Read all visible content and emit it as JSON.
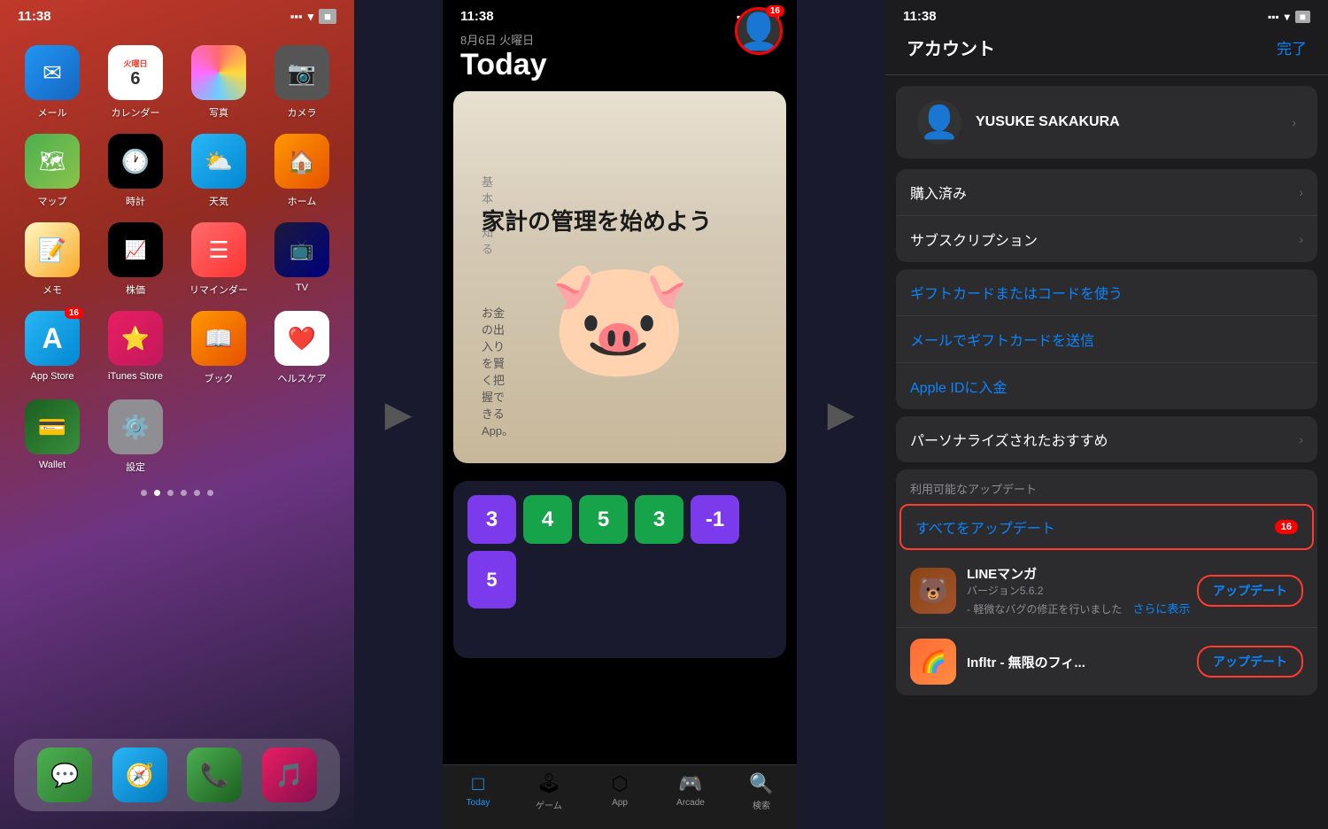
{
  "screen1": {
    "status": {
      "time": "11:38",
      "location_icon": "▲",
      "signal": "▪▪▪",
      "wifi": "WiFi",
      "battery": "🔋"
    },
    "apps_row1": [
      {
        "id": "mail",
        "label": "メール",
        "emoji": "✉️",
        "bg": "mail-bg",
        "badge": null
      },
      {
        "id": "calendar",
        "label": "カレンダー",
        "emoji": "cal",
        "bg": "calendar-bg",
        "badge": null
      },
      {
        "id": "photos",
        "label": "写真",
        "emoji": "🌈",
        "bg": "photos-bg",
        "badge": null
      },
      {
        "id": "camera",
        "label": "カメラ",
        "emoji": "📷",
        "bg": "camera-bg",
        "badge": null
      }
    ],
    "apps_row2": [
      {
        "id": "maps",
        "label": "マップ",
        "emoji": "🗺️",
        "bg": "maps-bg",
        "badge": null
      },
      {
        "id": "clock",
        "label": "時計",
        "emoji": "🕐",
        "bg": "clock-bg",
        "badge": null
      },
      {
        "id": "weather",
        "label": "天気",
        "emoji": "⛅",
        "bg": "weather-bg",
        "badge": null
      },
      {
        "id": "home",
        "label": "ホーム",
        "emoji": "🏠",
        "bg": "home-app-bg",
        "badge": null
      }
    ],
    "apps_row3": [
      {
        "id": "notes",
        "label": "メモ",
        "emoji": "📝",
        "bg": "notes-bg",
        "badge": null
      },
      {
        "id": "stocks",
        "label": "株価",
        "emoji": "📈",
        "bg": "stocks-bg",
        "badge": null
      },
      {
        "id": "reminders",
        "label": "リマインダー",
        "emoji": "🔴",
        "bg": "reminders-bg",
        "badge": null
      },
      {
        "id": "tv",
        "label": "TV",
        "emoji": "📺",
        "bg": "tv-bg",
        "badge": null
      }
    ],
    "apps_row4": [
      {
        "id": "appstore",
        "label": "App Store",
        "emoji": "A",
        "bg": "appstore-bg",
        "badge": "16"
      },
      {
        "id": "itunes",
        "label": "iTunes Store",
        "emoji": "⭐",
        "bg": "itunes-bg",
        "badge": null
      },
      {
        "id": "books",
        "label": "ブック",
        "emoji": "📖",
        "bg": "books-bg",
        "badge": null
      },
      {
        "id": "health",
        "label": "ヘルスケア",
        "emoji": "❤️",
        "bg": "health-bg",
        "badge": null
      }
    ],
    "apps_row5": [
      {
        "id": "wallet",
        "label": "Wallet",
        "emoji": "💳",
        "bg": "wallet-bg",
        "badge": null
      },
      {
        "id": "settings",
        "label": "設定",
        "emoji": "⚙️",
        "bg": "settings-bg",
        "badge": null
      }
    ],
    "calendar_day": "6",
    "calendar_weekday": "火曜日",
    "dock": [
      {
        "id": "messages",
        "emoji": "💬",
        "label": ""
      },
      {
        "id": "safari",
        "emoji": "🧭",
        "label": ""
      },
      {
        "id": "phone",
        "emoji": "📞",
        "label": ""
      },
      {
        "id": "music",
        "emoji": "🎵",
        "label": ""
      }
    ]
  },
  "screen2": {
    "status": {
      "time": "11:38",
      "location_icon": "▲"
    },
    "date": "8月6日 火曜日",
    "title": "Today",
    "avatar_badge": "16",
    "card1": {
      "label": "基本を知る",
      "title": "家計の管理を始めよう",
      "subtitle": "お金の出入りを賢く把握できるApp。"
    },
    "tabs": [
      {
        "id": "today",
        "label": "Today",
        "icon": "□",
        "active": true
      },
      {
        "id": "games",
        "label": "ゲーム",
        "icon": "🕹"
      },
      {
        "id": "apps",
        "label": "App",
        "icon": "⬡"
      },
      {
        "id": "arcade",
        "label": "Arcade",
        "icon": "🕹"
      },
      {
        "id": "search",
        "label": "検索",
        "icon": "🔍"
      }
    ],
    "game_tiles": [
      {
        "value": "3",
        "color": "purple"
      },
      {
        "value": "4",
        "color": "green"
      },
      {
        "value": "5",
        "color": "green"
      },
      {
        "value": "3",
        "color": "green"
      },
      {
        "value": "-1",
        "color": "purple"
      },
      {
        "value": "5",
        "color": "orange"
      }
    ]
  },
  "screen3": {
    "status": {
      "time": "11:38",
      "location_icon": "▲"
    },
    "header": {
      "title": "アカウント",
      "done_btn": "完了"
    },
    "user": {
      "name": "YUSUKE SAKAKURA"
    },
    "menu_items": [
      {
        "id": "purchased",
        "label": "購入済み"
      },
      {
        "id": "subscriptions",
        "label": "サブスクリプション"
      }
    ],
    "blue_items": [
      {
        "id": "gift-code",
        "label": "ギフトカードまたはコードを使う"
      },
      {
        "id": "send-gift",
        "label": "メールでギフトカードを送信"
      },
      {
        "id": "add-funds",
        "label": "Apple IDに入金"
      }
    ],
    "personalized": {
      "label": "パーソナライズされたおすすめ"
    },
    "updates_section": {
      "label": "利用可能なアップデート",
      "update_all": "すべてをアップデート",
      "badge": "16"
    },
    "app_updates": [
      {
        "id": "line-manga",
        "name": "LINEマンガ",
        "version": "バージョン5.6.2",
        "description": "- 軽微なバグの修正を行いました",
        "btn_label": "アップデート",
        "see_more": "さらに表示"
      },
      {
        "id": "infltr",
        "name": "Infltr - 無限のフィ...",
        "version": "",
        "description": "",
        "btn_label": "アップデート"
      }
    ]
  }
}
